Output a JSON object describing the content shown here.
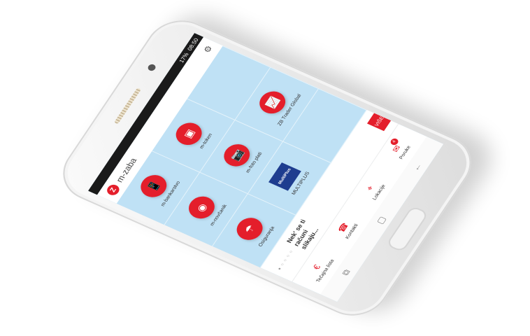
{
  "status": {
    "battery": "17%",
    "time": "08:50"
  },
  "app": {
    "title": "m-zaba"
  },
  "icons": {
    "gear": "gear-icon",
    "logo": "zaba-logo"
  },
  "tiles": [
    {
      "label": "m-bankarstvo",
      "icon": "📱"
    },
    {
      "label": "m-token",
      "icon": "▣"
    },
    {
      "label": "",
      "icon": ""
    },
    {
      "label": "m-novčanik",
      "icon": "◉"
    },
    {
      "label": "m-foto plati",
      "icon": "📷"
    },
    {
      "label": "ZB Trader Global",
      "icon": "📈"
    },
    {
      "label": "Osiguranja",
      "icon": "☂"
    },
    {
      "label": "MULTIPLUS",
      "icon": "MultiPlus"
    },
    {
      "label": "",
      "icon": ""
    }
  ],
  "banner": {
    "line1": "Nek' se ti",
    "line2": "računi",
    "line3": "slikaju...",
    "button": "VIŠE >"
  },
  "tabs": [
    {
      "label": "Tečajna lista",
      "icon": "€"
    },
    {
      "label": "Kontakti",
      "icon": "☎"
    },
    {
      "label": "Lokacije",
      "icon": "⌖"
    },
    {
      "label": "Poruke",
      "icon": "✉",
      "badge": "4"
    }
  ],
  "nav": {
    "recent": "⧉",
    "home": "▢",
    "back": "←"
  }
}
